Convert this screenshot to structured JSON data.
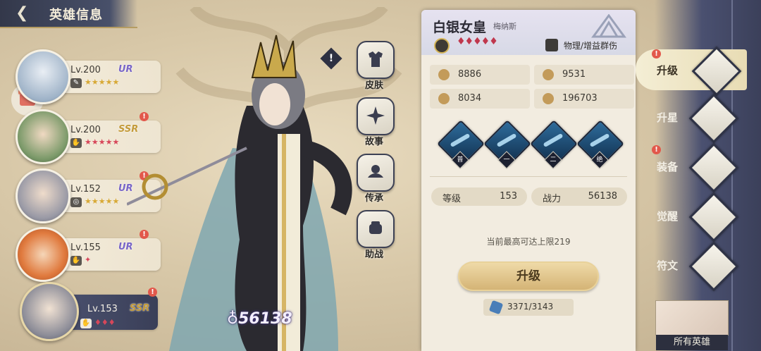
{
  "header": {
    "title": "英雄信息"
  },
  "hero_list": [
    {
      "level": "Lv.200",
      "rarity": "UR",
      "stars": "★★★★★",
      "star_color": "gold",
      "alert": false
    },
    {
      "level": "Lv.200",
      "rarity": "SSR",
      "stars": "★★★★★",
      "star_color": "red",
      "alert": true
    },
    {
      "level": "Lv.152",
      "rarity": "UR",
      "stars": "★★★★★",
      "star_color": "gold",
      "alert": true
    },
    {
      "level": "Lv.155",
      "rarity": "UR",
      "stars": "✦",
      "star_color": "red",
      "alert": true
    },
    {
      "level": "Lv.153",
      "rarity": "SSR",
      "stars": "♦♦♦",
      "star_color": "red",
      "alert": true
    }
  ],
  "power_display": "56138",
  "side_menu": [
    {
      "label": "皮肤",
      "icon": "shirt-icon"
    },
    {
      "label": "故事",
      "icon": "sparkle-icon"
    },
    {
      "label": "传承",
      "icon": "lotus-icon"
    },
    {
      "label": "助战",
      "icon": "fist-icon"
    }
  ],
  "hero": {
    "name": "白银女皇",
    "title": "梅纳斯",
    "rank_gems": "♦♦♦♦♦",
    "class_text": "物理/增益群伤"
  },
  "stats": {
    "attack": "8886",
    "defense": "9531",
    "armor": "8034",
    "hp": "196703"
  },
  "skills": [
    {
      "tag": "普"
    },
    {
      "tag": "一"
    },
    {
      "tag": "二"
    },
    {
      "tag": "绝"
    }
  ],
  "level_pill": {
    "label": "等级",
    "value": "153"
  },
  "power_pill": {
    "label": "战力",
    "value": "56138"
  },
  "level_cap_text": "当前最高可达上限219",
  "upgrade_button": "升级",
  "upgrade_cost": "3371/3143",
  "tabs": [
    {
      "label": "升级",
      "active": true,
      "alert": true
    },
    {
      "label": "升星",
      "active": false,
      "alert": false
    },
    {
      "label": "装备",
      "active": false,
      "alert": true
    },
    {
      "label": "觉醒",
      "active": false,
      "alert": false
    },
    {
      "label": "符文",
      "active": false,
      "alert": false
    }
  ],
  "all_heroes": "所有英雄",
  "colors": {
    "accent_gold": "#d3b273",
    "rail_navy": "#3b405a",
    "alert_red": "#e2584b",
    "rank_red": "#c0374d"
  }
}
